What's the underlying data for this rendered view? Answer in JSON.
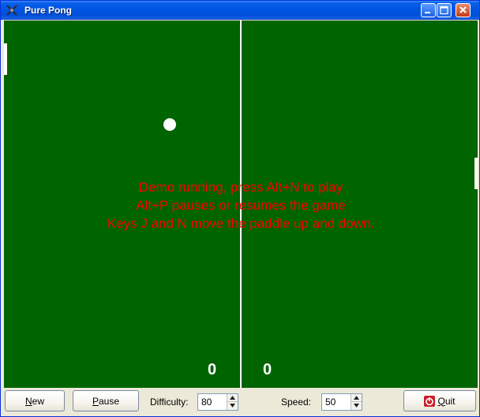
{
  "window": {
    "title": "Pure Pong",
    "icons": {
      "app": "crossed-paddles-icon",
      "minimize": "minimize-icon",
      "maximize": "maximize-icon",
      "close": "close-icon"
    }
  },
  "court": {
    "background_color": "#006400",
    "line_color": "#ffffff",
    "messages": [
      "Demo running, press Alt+N to play",
      "Alt+P pauses or resumes the game",
      "Keys J and N move the paddle up and down."
    ],
    "message_color": "#ff0000",
    "scores": {
      "left": "0",
      "right": "0"
    }
  },
  "controls": {
    "new_label_mnemonic": "N",
    "new_label_rest": "ew",
    "pause_label_mnemonic": "P",
    "pause_label_rest": "ause",
    "difficulty_label": "Difficulty:",
    "difficulty_value": "80",
    "speed_label": "Speed:",
    "speed_value": "50",
    "quit_label_mnemonic": "Q",
    "quit_label_rest": "uit",
    "quit_icon": "power-icon"
  }
}
